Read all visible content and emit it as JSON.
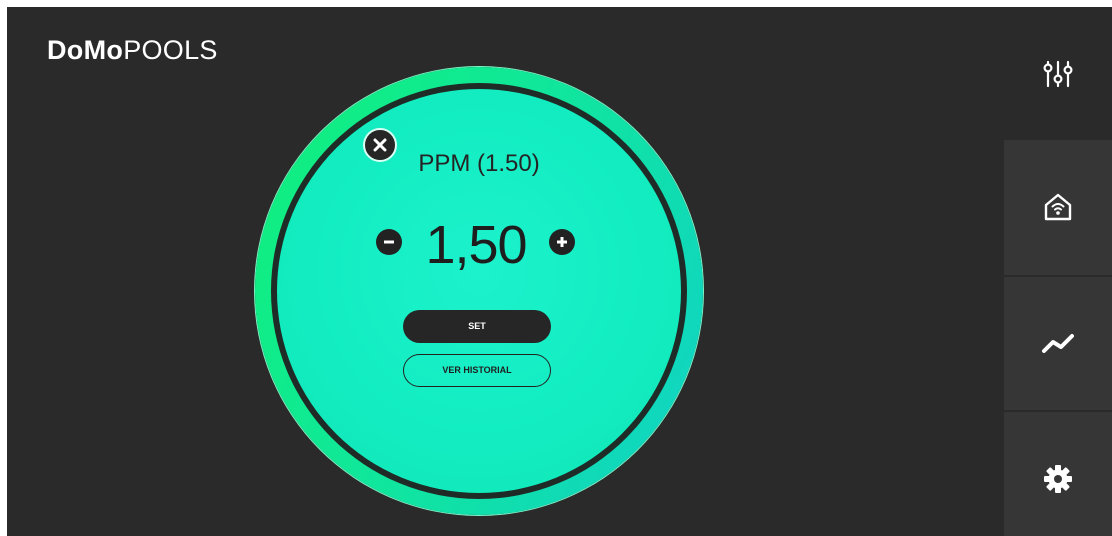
{
  "header": {
    "brand_bold": "DoMo",
    "brand_light": "POOLS"
  },
  "sidebar": {
    "top_icon": "sliders-icon",
    "items": [
      {
        "icon": "smart-home-icon"
      },
      {
        "icon": "trend-chart-icon"
      },
      {
        "icon": "gear-icon"
      }
    ]
  },
  "panel": {
    "title": "PPM (1.50)",
    "value": "1,50",
    "set_label": "SET",
    "history_label": "VER HISTORIAL",
    "close_icon": "close-icon",
    "minus_icon": "minus-icon",
    "plus_icon": "plus-icon"
  },
  "colors": {
    "background": "#2a2a2a",
    "sidebar": "#363636",
    "gauge_green": "#10f07a",
    "gauge_cyan": "#10d2c8",
    "inner_fill": "#12ecc0"
  }
}
